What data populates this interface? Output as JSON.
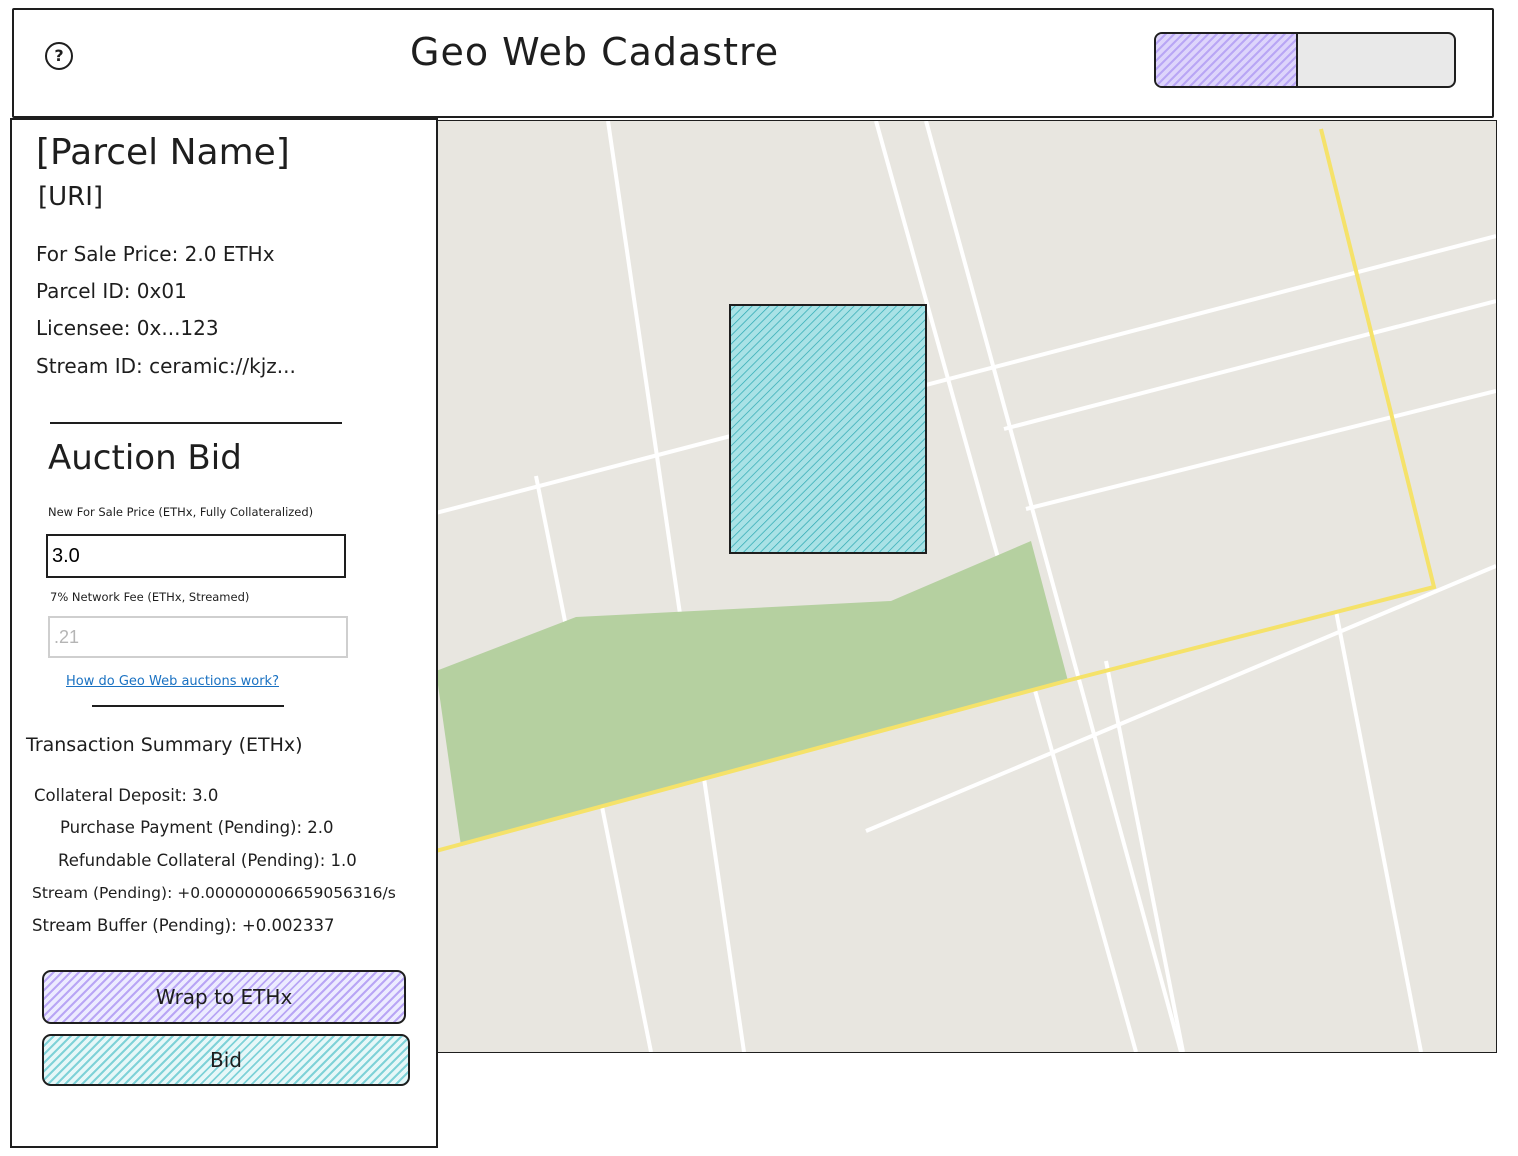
{
  "header": {
    "title": "Geo Web Cadastre",
    "help_icon": "?"
  },
  "parcel": {
    "name": "[Parcel Name]",
    "uri": "[URI]",
    "for_sale_price": "For Sale Price: 2.0 ETHx",
    "parcel_id": "Parcel ID: 0x01",
    "licensee": "Licensee: 0x...123",
    "stream_id": "Stream ID: ceramic://kjz..."
  },
  "auction": {
    "title": "Auction Bid",
    "new_price_label": "New For Sale Price (ETHx, Fully Collateralized)",
    "new_price_value": "3.0",
    "fee_label": "7% Network Fee (ETHx, Streamed)",
    "fee_value": ".21",
    "help_link": "How do Geo Web auctions work?"
  },
  "transaction_summary": {
    "title": "Transaction Summary (ETHx)",
    "collateral_deposit": "Collateral Deposit: 3.0",
    "purchase_payment": "Purchase Payment (Pending): 2.0",
    "refundable_collateral": "Refundable Collateral (Pending): 1.0",
    "stream": "Stream (Pending): +0.000000006659056316/s",
    "stream_buffer": "Stream Buffer (Pending): +0.002337"
  },
  "buttons": {
    "wrap": "Wrap to ETHx",
    "bid": "Bid"
  },
  "colors": {
    "wrap_accent": "#b9a6f5",
    "bid_accent": "#7fd2d8",
    "map_background": "#e8e6e0",
    "park": "#b5d0a0",
    "selected_parcel": "#7fd2d8",
    "boundary": "#f5e26a"
  }
}
